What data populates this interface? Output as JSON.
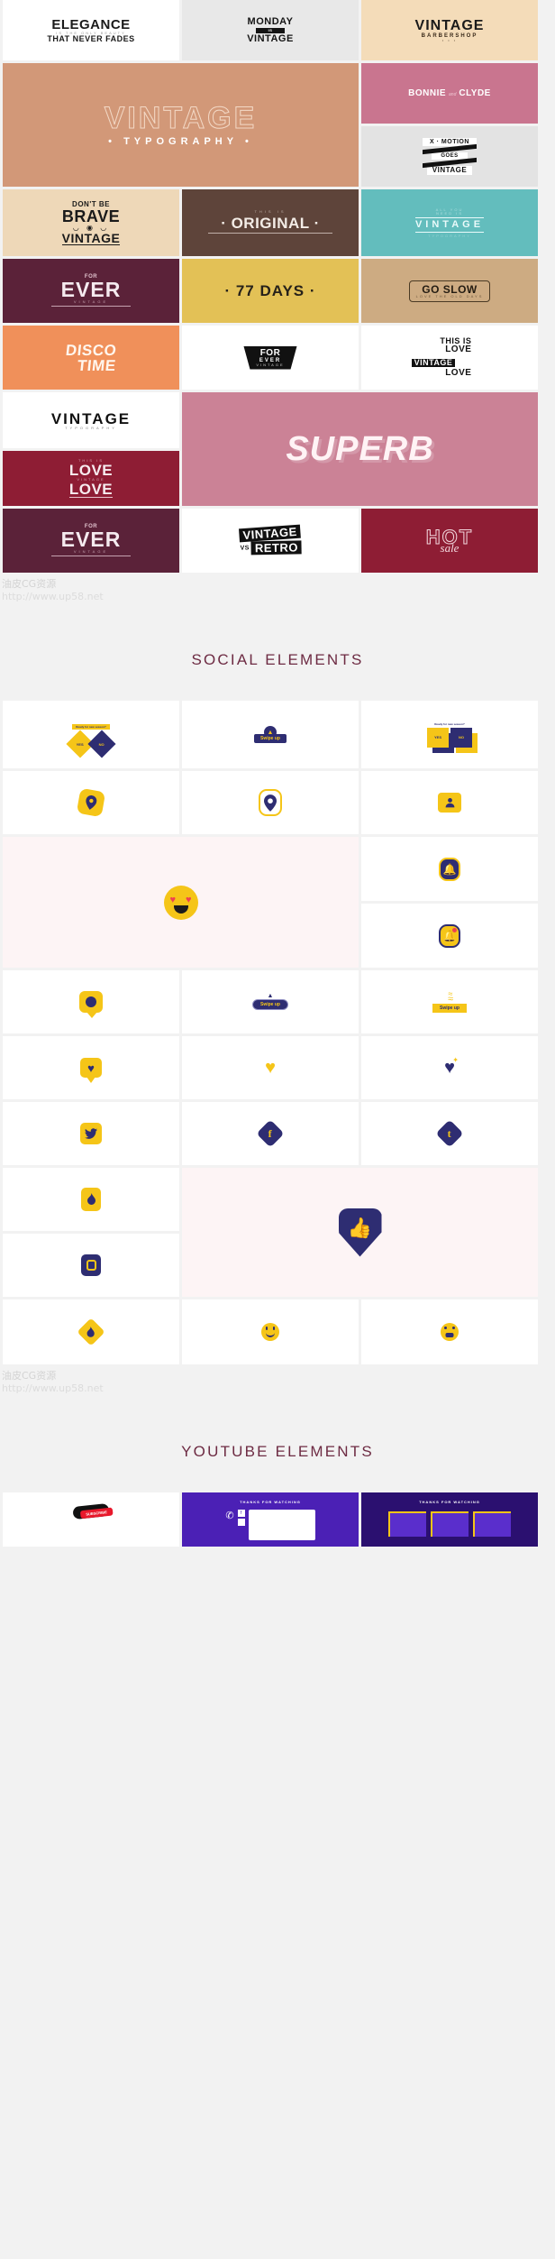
{
  "watermarks": [
    {
      "line1": "油皮CG资源",
      "line2": "http://www.up58.net"
    },
    {
      "line1": "油皮CG资源",
      "line2": "http://www.up58.net"
    }
  ],
  "sections": [
    {
      "id": "typography",
      "title": ""
    },
    {
      "id": "social",
      "title": "SOCIAL ELEMENTS"
    },
    {
      "id": "youtube",
      "title": "YOUTUBE ELEMENTS"
    }
  ],
  "colors": {
    "page_background": "#f2f2f2",
    "heading": "#6d2b43",
    "watermark": "#d3d3d3",
    "social_yellow": "#f5c518",
    "social_navy": "#2e2d72",
    "youtube_purple": "#4b20b5",
    "youtube_red": "#e8182b"
  },
  "typography_cards": [
    {
      "id": "elegance",
      "bg": "#ffffff",
      "fg": "#1a1a1a",
      "lines": [
        "ELEGANCE",
        "IS THE ONLY BEAUTY",
        "THAT NEVER FADES"
      ]
    },
    {
      "id": "monday",
      "bg": "#e8e8e8",
      "fg": "#141414",
      "lines": [
        "MONDAY",
        "IS",
        "VINTAGE"
      ]
    },
    {
      "id": "barbershop",
      "bg": "#f4dcb9",
      "fg": "#1a1a1a",
      "lines": [
        "VINTAGE",
        "BARBERSHOP",
        "• • •"
      ]
    },
    {
      "id": "vintage-typography",
      "bg": "#d29878",
      "fg": "#ffffff",
      "lines": [
        "VINTAGE",
        "• TYPOGRAPHY •"
      ]
    },
    {
      "id": "bonnie-clyde",
      "bg": "#c9758f",
      "fg": "#ffffff",
      "lines": [
        "BONNIE",
        "and",
        "CLYDE"
      ]
    },
    {
      "id": "x-motion",
      "bg": "#e3e3e3",
      "fg": "#111111",
      "lines": [
        "X · MOTION",
        "GOES",
        "VINTAGE"
      ]
    },
    {
      "id": "dont-be-brave",
      "bg": "#eed8b8",
      "fg": "#1a1a1a",
      "lines": [
        "DON'T BE",
        "BRAVE",
        "VINTAGE"
      ]
    },
    {
      "id": "this-is-original",
      "bg": "#5e443a",
      "fg": "#f3ece6",
      "lines": [
        "THIS IS",
        "· ORIGINAL ·"
      ]
    },
    {
      "id": "all-you-need-vintage",
      "bg": "#63bdbd",
      "fg": "#eafafa",
      "lines": [
        "ALL YOU",
        "NEED IS",
        "VINTAGE",
        "TYPOGRAPHY"
      ]
    },
    {
      "id": "for-ever-plum",
      "bg": "#5b2239",
      "fg": "#f5eaef",
      "lines": [
        "FOR",
        "EVER",
        "VINTAGE"
      ]
    },
    {
      "id": "77-days",
      "bg": "#e3c156",
      "fg": "#26211a",
      "lines": [
        "· 77 DAYS ·"
      ]
    },
    {
      "id": "go-slow",
      "bg": "#cdab82",
      "fg": "#241c12",
      "lines": [
        "GO SLOW",
        "LOVE THE OLD DAYS"
      ]
    },
    {
      "id": "disco-time",
      "bg": "#f0905a",
      "fg": "#fff6ee",
      "lines": [
        "DISCO",
        "TIME"
      ]
    },
    {
      "id": "for-ever-black",
      "bg": "#ffffff",
      "fg": "#111111",
      "lines": [
        "FOR",
        "EVER",
        "VINTAGE"
      ]
    },
    {
      "id": "this-is-love",
      "bg": "#ffffff",
      "fg": "#111111",
      "lines": [
        "THIS IS",
        "LOVE",
        "VINTAGE",
        "LOVE"
      ]
    },
    {
      "id": "vintage-typography-white",
      "bg": "#ffffff",
      "fg": "#111111",
      "lines": [
        "VINTAGE",
        "TYPOGRAPHY"
      ]
    },
    {
      "id": "superb",
      "bg": "#cb8296",
      "fg": "#fff3f5",
      "lines": [
        "SUPERB"
      ]
    },
    {
      "id": "love-love",
      "bg": "#8e1d34",
      "fg": "#f7ecef",
      "lines": [
        "THIS IS",
        "LOVE",
        "VINTAGE",
        "LOVE"
      ]
    },
    {
      "id": "for-ever-plum-2",
      "bg": "#5b2239",
      "fg": "#f5eaef",
      "lines": [
        "FOR",
        "EVER",
        "VINTAGE"
      ]
    },
    {
      "id": "vintage-vs-retro",
      "bg": "#ffffff",
      "fg": "#111111",
      "lines": [
        "VINTAGE",
        "VS",
        "RETRO"
      ]
    },
    {
      "id": "hot-sale",
      "bg": "#8e1d34",
      "fg": "#f3d8de",
      "lines": [
        "HOT",
        "sale"
      ]
    }
  ],
  "social_cards": [
    {
      "id": "poll-yes-no-diamond",
      "icon": "poll-diamond-icon",
      "label_top": "Ready for new season?",
      "yes": "YES",
      "no": "NO"
    },
    {
      "id": "swipe-up-badge",
      "icon": "swipe-up-badge-icon",
      "label": "Swipe up"
    },
    {
      "id": "poll-yes-no-square",
      "icon": "poll-square-icon",
      "label_top": "Ready for new season?",
      "yes": "YES",
      "no": "NO"
    },
    {
      "id": "location-burst",
      "icon": "location-pin-burst-icon"
    },
    {
      "id": "location-pin",
      "icon": "location-pin-icon"
    },
    {
      "id": "contact-card",
      "icon": "contact-card-icon"
    },
    {
      "id": "heart-eyes",
      "icon": "heart-eyes-emoji-icon"
    },
    {
      "id": "bell-badge",
      "icon": "bell-badge-icon"
    },
    {
      "id": "bell-alert",
      "icon": "bell-alert-icon"
    },
    {
      "id": "chat-bubble",
      "icon": "chat-bubble-icon"
    },
    {
      "id": "swipe-up-pill",
      "icon": "swipe-up-pill-icon",
      "label": "Swipe up"
    },
    {
      "id": "swipe-up-lines",
      "icon": "swipe-up-lines-icon",
      "label": "Swipe up"
    },
    {
      "id": "heart-bubble",
      "icon": "heart-bubble-icon"
    },
    {
      "id": "heart-yellow",
      "icon": "heart-icon"
    },
    {
      "id": "heart-spark",
      "icon": "heart-spark-icon"
    },
    {
      "id": "twitter",
      "icon": "twitter-icon"
    },
    {
      "id": "facebook",
      "icon": "facebook-icon"
    },
    {
      "id": "tumblr",
      "icon": "tumblr-icon"
    },
    {
      "id": "flame-square",
      "icon": "flame-square-icon"
    },
    {
      "id": "thumbs-up-pin",
      "icon": "thumbs-up-pin-icon"
    },
    {
      "id": "instagram",
      "icon": "instagram-icon"
    },
    {
      "id": "flame-diamond",
      "icon": "flame-diamond-icon"
    },
    {
      "id": "smiley",
      "icon": "smiley-face-icon"
    },
    {
      "id": "grin",
      "icon": "grinning-face-icon"
    }
  ],
  "youtube_cards": [
    {
      "id": "subscribe-button",
      "label": "SUBSCRIBE"
    },
    {
      "id": "end-screen-social",
      "label": "THANKS FOR WATCHING"
    },
    {
      "id": "end-screen-grid",
      "label": "THANKS FOR WATCHING"
    }
  ]
}
